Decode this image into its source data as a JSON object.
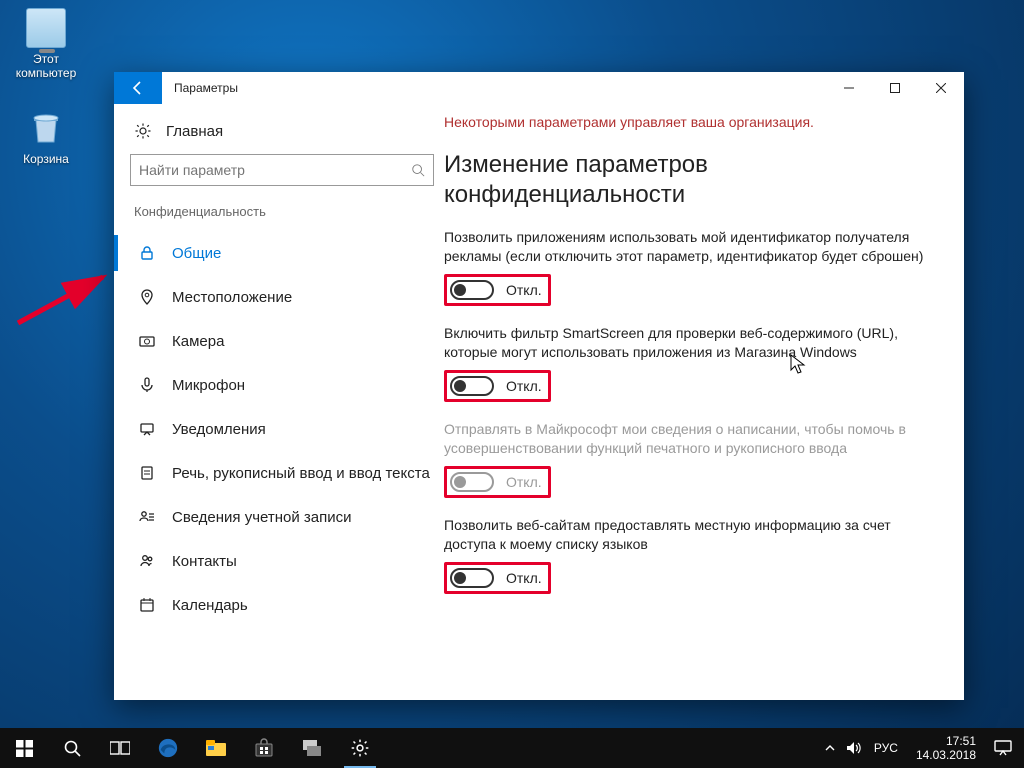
{
  "desktop": {
    "this_pc": "Этот компьютер",
    "recycle_bin": "Корзина"
  },
  "window": {
    "title": "Параметры",
    "home": "Главная",
    "search_placeholder": "Найти параметр",
    "section": "Конфиденциальность"
  },
  "nav": {
    "items": [
      {
        "label": "Общие"
      },
      {
        "label": "Местоположение"
      },
      {
        "label": "Камера"
      },
      {
        "label": "Микрофон"
      },
      {
        "label": "Уведомления"
      },
      {
        "label": "Речь, рукописный ввод и ввод текста"
      },
      {
        "label": "Сведения учетной записи"
      },
      {
        "label": "Контакты"
      },
      {
        "label": "Календарь"
      }
    ]
  },
  "content": {
    "org_warning": "Некоторыми параметрами управляет ваша организация.",
    "heading": "Изменение параметров конфиденциальности",
    "settings": [
      {
        "desc": "Позволить приложениям использовать мой идентификатор получателя рекламы (если отключить этот параметр, идентификатор будет сброшен)",
        "state": "Откл."
      },
      {
        "desc": "Включить фильтр SmartScreen для проверки веб-содержимого (URL), которые могут использовать приложения из Магазина Windows",
        "state": "Откл."
      },
      {
        "desc": "Отправлять в Майкрософт мои сведения о написании, чтобы помочь в усовершенствовании функций печатного и рукописного ввода",
        "state": "Откл."
      },
      {
        "desc": "Позволить веб-сайтам предоставлять местную информацию за счет доступа к моему списку языков",
        "state": "Откл."
      }
    ]
  },
  "taskbar": {
    "lang": "РУС",
    "time": "17:51",
    "date": "14.03.2018"
  }
}
